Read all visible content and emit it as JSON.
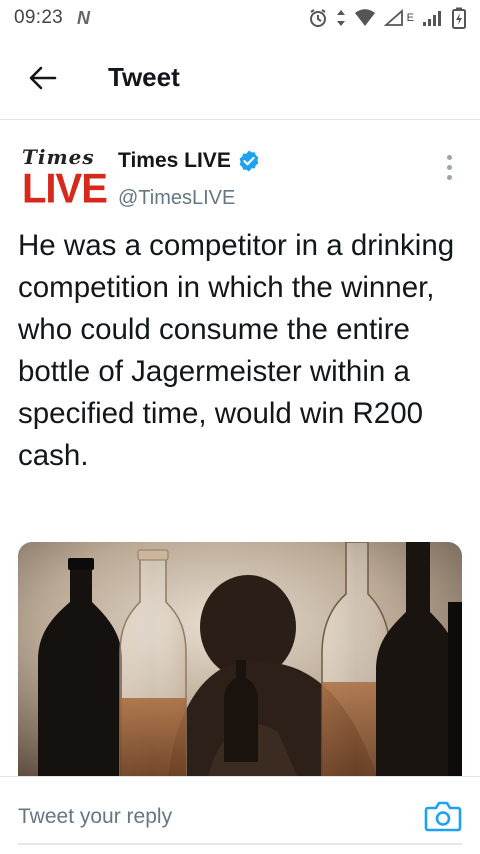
{
  "status_bar": {
    "time": "09:23",
    "notification_icon": "N",
    "icons": [
      "alarm-icon",
      "data-arrows-icon",
      "wifi-icon",
      "signal-icon",
      "battery-icon"
    ],
    "network_label": "E"
  },
  "app_bar": {
    "back_icon": "arrow-left-icon",
    "title": "Tweet"
  },
  "tweet": {
    "logo": {
      "line1": "Times",
      "line2": "LIVE"
    },
    "author_name": "Times LIVE",
    "verified": true,
    "handle": "@TimesLIVE",
    "text": "He was a competitor in a drinking competition in which the winner, who could consume the entire bottle of Jagermeister within a specified time, would win R200 cash.",
    "media": {
      "subject": "bottles-photo"
    }
  },
  "reply": {
    "placeholder": "Tweet your reply",
    "camera_icon": "camera-icon"
  },
  "colors": {
    "accent": "#1da1f2",
    "text_primary": "#14171a",
    "text_secondary": "#657786",
    "brand_red": "#d6281b",
    "divider": "#e1e8ed"
  }
}
